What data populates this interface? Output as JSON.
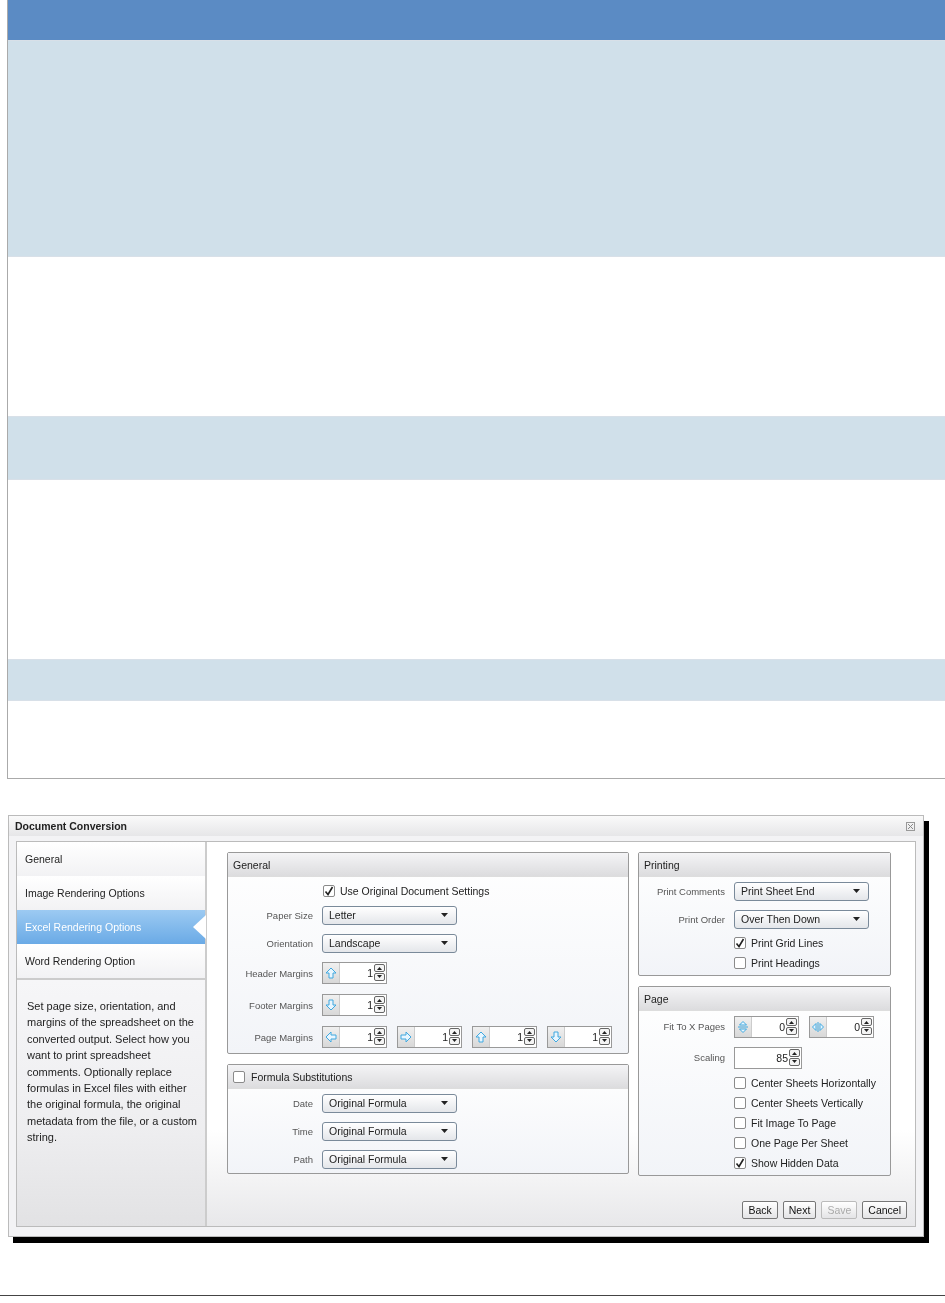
{
  "table": {
    "rows": [
      {
        "shaded": true
      },
      {
        "shaded": false
      },
      {
        "shaded": true
      },
      {
        "shaded": false
      },
      {
        "shaded": true
      },
      {
        "shaded": false
      }
    ]
  },
  "dialog": {
    "title": "Document Conversion",
    "nav": [
      {
        "label": "General",
        "selected": false
      },
      {
        "label": "Image Rendering Options",
        "selected": false
      },
      {
        "label": "Excel Rendering Options",
        "selected": true
      },
      {
        "label": "Word Rendering Option",
        "selected": false
      }
    ],
    "description": "Set page size, orientation, and margins of the spreadsheet on the converted output. Select how you want to print spreadsheet comments. Optionally replace formulas in Excel files with either the original formula, the original metadata from the file, or a custom string.",
    "general": {
      "title": "General",
      "use_original": {
        "label": "Use Original Document Settings",
        "checked": true
      },
      "fields": [
        {
          "kind": "dropdown",
          "label": "Paper Size",
          "value": "Letter"
        },
        {
          "kind": "dropdown",
          "label": "Orientation",
          "value": "Landscape"
        },
        {
          "kind": "spinners",
          "label": "Header Margins",
          "spinners": [
            {
              "kind": "up",
              "value": "1"
            }
          ]
        },
        {
          "kind": "spinners",
          "label": "Footer Margins",
          "spinners": [
            {
              "kind": "down",
              "value": "1"
            }
          ]
        },
        {
          "kind": "spinners",
          "label": "Page Margins",
          "spinners": [
            {
              "kind": "left",
              "value": "1"
            },
            {
              "kind": "right",
              "value": "1"
            },
            {
              "kind": "up",
              "value": "1"
            },
            {
              "kind": "down",
              "value": "1"
            }
          ]
        }
      ]
    },
    "formula": {
      "title": "Formula Substitutions",
      "checked": false,
      "fields": [
        {
          "kind": "dropdown",
          "label": "Date",
          "value": "Original Formula"
        },
        {
          "kind": "dropdown",
          "label": "Time",
          "value": "Original Formula"
        },
        {
          "kind": "dropdown",
          "label": "Path",
          "value": "Original Formula"
        }
      ]
    },
    "printing": {
      "title": "Printing",
      "fields": [
        {
          "kind": "dropdown",
          "label": "Print Comments",
          "value": "Print Sheet End"
        },
        {
          "kind": "dropdown",
          "label": "Print Order",
          "value": "Over Then Down"
        }
      ],
      "checks": [
        {
          "label": "Print Grid Lines",
          "checked": true
        },
        {
          "label": "Print Headings",
          "checked": false
        }
      ]
    },
    "page": {
      "title": "Page",
      "fields": [
        {
          "kind": "spinners",
          "label": "Fit To X Pages",
          "spinners": [
            {
              "kind": "vertical",
              "value": "0"
            },
            {
              "kind": "horizontal",
              "value": "0"
            }
          ]
        },
        {
          "kind": "spinners",
          "label": "Scaling",
          "spinners": [
            {
              "kind": "plain",
              "value": "85"
            }
          ]
        }
      ],
      "checks": [
        {
          "label": "Center Sheets Horizontally",
          "checked": false
        },
        {
          "label": "Center Sheets Vertically",
          "checked": false
        },
        {
          "label": "Fit Image To Page",
          "checked": false
        },
        {
          "label": "One Page Per Sheet",
          "checked": false
        },
        {
          "label": "Show Hidden Data",
          "checked": true
        }
      ]
    },
    "buttons": [
      {
        "label": "Back",
        "disabled": false
      },
      {
        "label": "Next",
        "disabled": false
      },
      {
        "label": "Save",
        "disabled": true
      },
      {
        "label": "Cancel",
        "disabled": false
      }
    ]
  }
}
